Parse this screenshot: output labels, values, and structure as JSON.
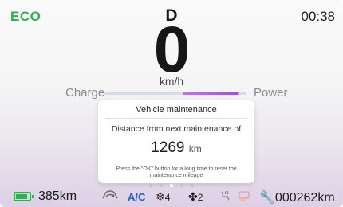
{
  "top": {
    "drive_mode": "ECO",
    "gear": "D",
    "clock": "00:38"
  },
  "speed": {
    "value": "0",
    "unit": "km/h"
  },
  "power_gauge": {
    "left_label": "Charge",
    "right_label": "Power"
  },
  "dialog": {
    "title": "Vehicle maintenance",
    "message": "Distance from next maintenance of",
    "value": "1269",
    "unit": "km",
    "note": "Press the \"OK\" button for a long time to reset the maintenance mileage"
  },
  "pager": {
    "count": 5,
    "active_index": 2
  },
  "status": {
    "battery_range": "385km",
    "ac_label": "A/C",
    "temp_setting": "4",
    "fan_speed": "2",
    "odometer": "000262km"
  },
  "colors": {
    "eco_green": "#2ab34a",
    "ac_blue": "#1f5fd6",
    "power_purple": "#a64fda"
  },
  "icons": {
    "battery": "battery-icon",
    "recirculation": "air-recirculation-icon",
    "temperature": "snowflake-icon",
    "fan": "fan-icon",
    "seat_heat": "seat-heater-icon",
    "defrost": "rear-defrost-icon",
    "service": "wrench-icon"
  }
}
